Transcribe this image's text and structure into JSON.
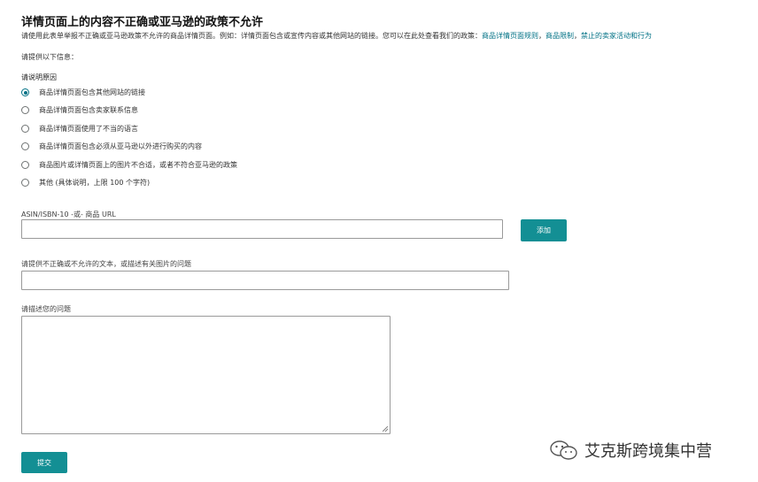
{
  "page": {
    "title": "详情页面上的内容不正确或亚马逊的政策不允许",
    "intro_text": "请使用此表单举报不正确或亚马逊政策不允许的商品详情页面。例如：详情页面包含或宣传内容或其他网站的链接。您可以在此处查看我们的政策：",
    "policy_links": [
      "商品详情页面规则",
      "商品限制",
      "禁止的卖家活动和行为"
    ],
    "link_separator": "，",
    "info_label": "请提供以下信息：",
    "reason_heading": "请说明原因"
  },
  "reasons": [
    {
      "label": "商品详情页面包含其他网站的链接",
      "checked": true
    },
    {
      "label": "商品详情页面包含卖家联系信息",
      "checked": false
    },
    {
      "label": "商品详情页面使用了不当的语言",
      "checked": false
    },
    {
      "label": "商品详情页面包含必须从亚马逊以外进行购买的内容",
      "checked": false
    },
    {
      "label": "商品图片或详情页面上的图片不合适，或者不符合亚马逊的政策",
      "checked": false
    },
    {
      "label": "其他 (具体说明，上限 100 个字符)",
      "checked": false
    }
  ],
  "form": {
    "asin_label": "ASIN/ISBN-10 -或- 商品 URL",
    "asin_value": "",
    "add_button": "添加",
    "text_label": "请提供不正确或不允许的文本，或描述有关图片的问题",
    "text_value": "",
    "describe_label": "请描述您的问题",
    "describe_value": "",
    "submit_button": "提交"
  },
  "watermark": {
    "text": "艾克斯跨境集中营",
    "icon": "wechat-icon"
  },
  "colors": {
    "accent": "#007185",
    "button": "#138f94"
  }
}
